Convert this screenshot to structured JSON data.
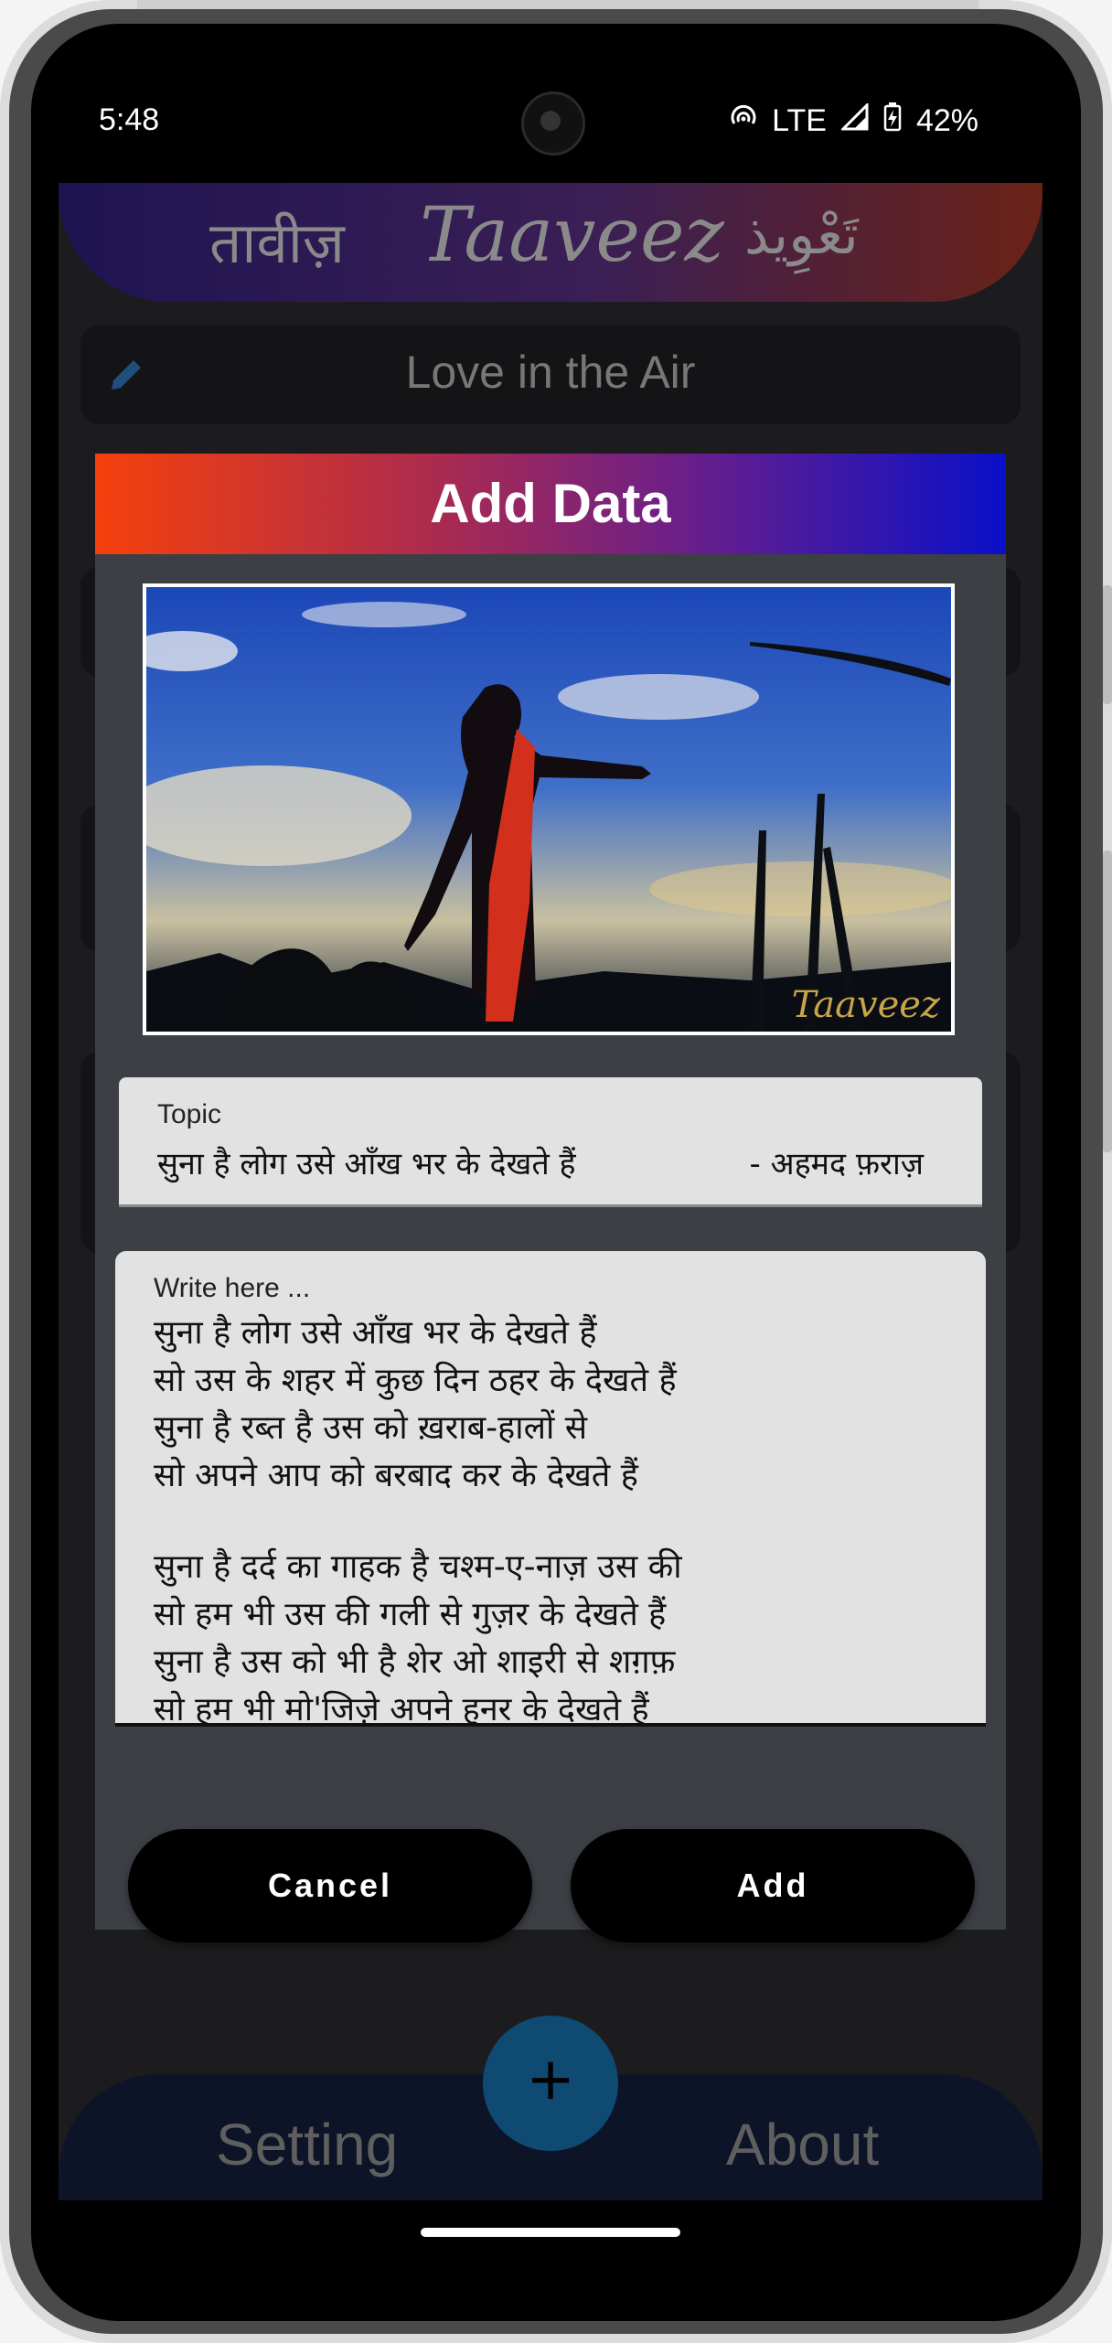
{
  "status_bar": {
    "time": "5:48",
    "network": "LTE",
    "battery": "42%"
  },
  "app_header": {
    "hindi": "तावीज़",
    "latin": "Taaveez",
    "urdu": "تَعْوِیذ"
  },
  "current_title": "Love in the Air",
  "bottom_nav": {
    "left": "Setting",
    "right": "About",
    "fab_symbol": "+"
  },
  "dialog": {
    "title": "Add Data",
    "image_watermark": "Taaveez",
    "topic": {
      "label": "Topic",
      "value": "सुना है लोग उसे आँख भर के देखते हैं",
      "author": "- अहमद फ़राज़"
    },
    "write": {
      "label": "Write here ...",
      "lines": [
        "सुना है लोग उसे आँख भर के देखते हैं",
        "सो उस के शहर में कुछ दिन ठहर के देखते हैं",
        "सुना है रब्त है उस को ख़राब-हालों से",
        "सो अपने आप को बरबाद कर के देखते हैं",
        "",
        "सुना है दर्द का गाहक है चश्म-ए-नाज़ उस की",
        "सो हम भी उस की गली से गुज़र के देखते हैं",
        "सुना है उस को भी है शेर ओ शाइरी से शग़फ़",
        "सो हम भी मो'जिज़े अपने हुनर के देखते हैं"
      ]
    },
    "buttons": {
      "cancel": "Cancel",
      "add": "Add"
    }
  },
  "colors": {
    "dialog_bg": "#3c3f44",
    "header_gradient_start": "#f5400c",
    "header_gradient_end": "#0a10c8",
    "button_bg": "#000000"
  }
}
